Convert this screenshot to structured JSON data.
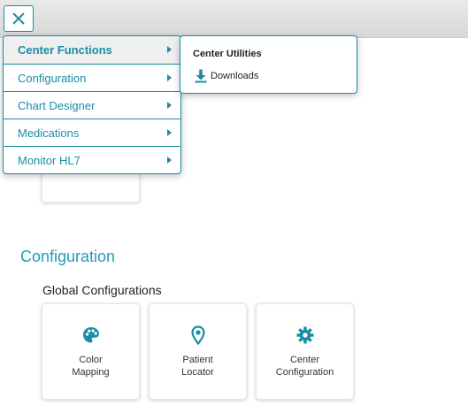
{
  "menu": {
    "items": [
      {
        "label": "Center Functions"
      },
      {
        "label": "Configuration"
      },
      {
        "label": "Chart Designer"
      },
      {
        "label": "Medications"
      },
      {
        "label": "Monitor HL7"
      }
    ]
  },
  "submenu": {
    "heading": "Center Utilities",
    "items": [
      {
        "label": "Downloads",
        "icon": "download-icon"
      }
    ]
  },
  "main": {
    "section_title": "Configuration",
    "subsection_title": "Global Configurations",
    "tiles": [
      {
        "label": "Color\nMapping",
        "icon": "palette-icon"
      },
      {
        "label": "Patient\nLocator",
        "icon": "map-pin-icon"
      },
      {
        "label": "Center\nConfiguration",
        "icon": "gear-icon"
      }
    ]
  },
  "colors": {
    "accent": "#1a8ea7",
    "section_title": "#1f9cbc"
  }
}
